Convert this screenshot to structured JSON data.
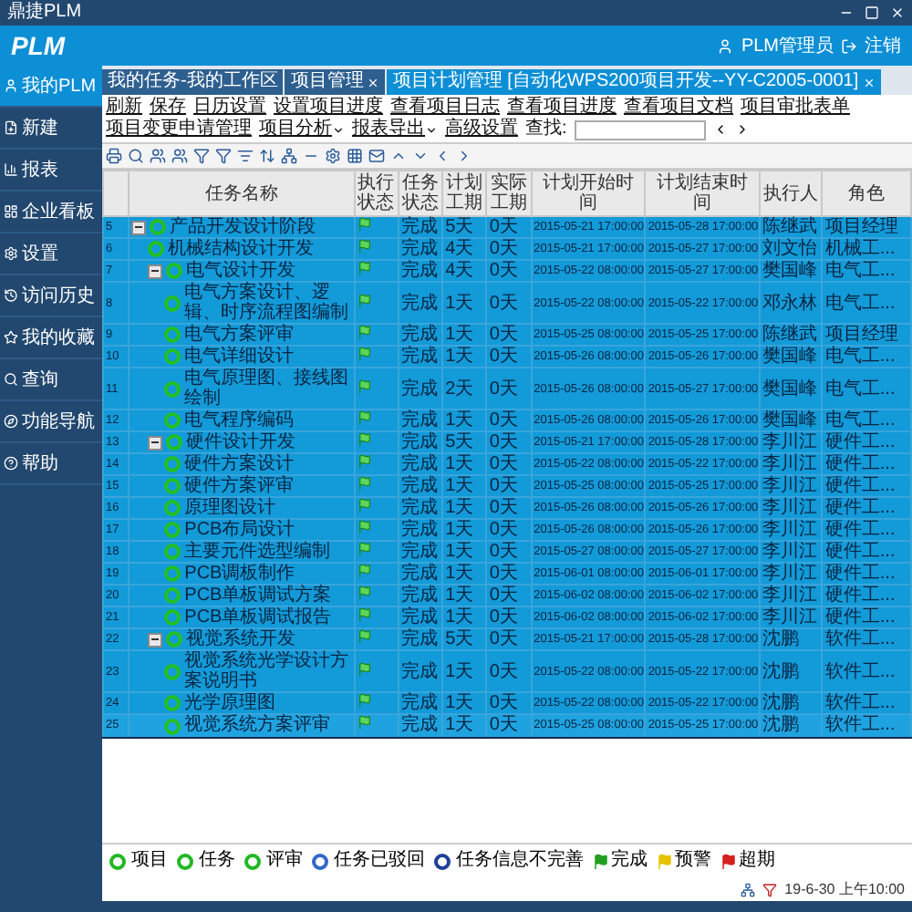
{
  "window": {
    "title": "鼎捷PLM"
  },
  "header": {
    "logo": "PLM",
    "user": "PLM管理员",
    "logout": "注销"
  },
  "sidebar": {
    "items": [
      {
        "label": "我的PLM",
        "selected": true
      },
      {
        "label": "新建",
        "selected": false
      },
      {
        "label": "报表",
        "selected": false
      },
      {
        "label": "企业看板",
        "selected": false
      },
      {
        "label": "设置",
        "selected": false
      },
      {
        "label": "访问历史",
        "selected": false
      },
      {
        "label": "我的收藏",
        "selected": false
      },
      {
        "label": "查询",
        "selected": false
      },
      {
        "label": "功能导航",
        "selected": false
      },
      {
        "label": "帮助",
        "selected": false
      }
    ]
  },
  "tabs": [
    {
      "label": "我的任务-我的工作区",
      "selected": false,
      "closable": false
    },
    {
      "label": "项目管理",
      "selected": false,
      "closable": true
    },
    {
      "label": "项目计划管理 [自动化WPS200项目开发--YY-C2005-0001]",
      "selected": true,
      "closable": true
    }
  ],
  "menu": [
    {
      "label": "刷新",
      "kind": "link"
    },
    {
      "label": "保存",
      "kind": "link"
    },
    {
      "label": "日历设置",
      "kind": "link"
    },
    {
      "label": "设置项目进度",
      "kind": "link"
    },
    {
      "label": "查看项目日志",
      "kind": "link"
    },
    {
      "label": "查看项目进度",
      "kind": "link"
    },
    {
      "label": "查看项目文档",
      "kind": "link"
    },
    {
      "label": "项目审批表单",
      "kind": "link"
    },
    {
      "label": "项目变更申请管理",
      "kind": "link"
    },
    {
      "label": "项目分析",
      "kind": "dropdown"
    },
    {
      "label": "报表导出",
      "kind": "dropdown"
    },
    {
      "label": "高级设置",
      "kind": "link"
    }
  ],
  "search": {
    "label": "查找:"
  },
  "table": {
    "columns": [
      "任务名称",
      "执行状态",
      "任务状态",
      "计划工期",
      "实际工期",
      "计划开始时间",
      "计划结束时间",
      "执行人",
      "角色"
    ],
    "rows": [
      {
        "num": "5",
        "name": "产品开发设计阶段",
        "status": "完成",
        "plan": "5天",
        "actual": "0天",
        "start": "2015-05-21 17:00:00",
        "end": "2015-05-28 17:00:00",
        "person": "陈继武",
        "role": "项目经理",
        "selected": false,
        "expanded": true,
        "children": [
          {
            "num": "6",
            "name": "机械结构设计开发",
            "status": "完成",
            "plan": "4天",
            "actual": "0天",
            "start": "2015-05-21 17:00:00",
            "end": "2015-05-27 17:00:00",
            "person": "刘文怡",
            "role": "机械工...",
            "selected": false
          },
          {
            "num": "7",
            "name": "电气设计开发",
            "status": "完成",
            "plan": "4天",
            "actual": "0天",
            "start": "2015-05-22 08:00:00",
            "end": "2015-05-27 17:00:00",
            "person": "樊国峰",
            "role": "电气工...",
            "selected": false,
            "expanded": true,
            "children": [
              {
                "num": "8",
                "name": "电气方案设计、逻辑、时序流程图编制",
                "status": "完成",
                "plan": "1天",
                "actual": "0天",
                "start": "2015-05-22 08:00:00",
                "end": "2015-05-22 17:00:00",
                "person": "邓永林",
                "role": "电气工...",
                "selected": false
              },
              {
                "num": "9",
                "name": "电气方案评审",
                "status": "完成",
                "plan": "1天",
                "actual": "0天",
                "start": "2015-05-25 08:00:00",
                "end": "2015-05-25 17:00:00",
                "person": "陈继武",
                "role": "项目经理",
                "selected": false
              },
              {
                "num": "10",
                "name": "电气详细设计",
                "status": "完成",
                "plan": "1天",
                "actual": "0天",
                "start": "2015-05-26 08:00:00",
                "end": "2015-05-26 17:00:00",
                "person": "樊国峰",
                "role": "电气工...",
                "selected": false
              },
              {
                "num": "11",
                "name": "电气原理图、接线图绘制",
                "status": "完成",
                "plan": "2天",
                "actual": "0天",
                "start": "2015-05-26 08:00:00",
                "end": "2015-05-27 17:00:00",
                "person": "樊国峰",
                "role": "电气工...",
                "selected": false
              },
              {
                "num": "12",
                "name": "电气程序编码",
                "status": "完成",
                "plan": "1天",
                "actual": "0天",
                "start": "2015-05-26 08:00:00",
                "end": "2015-05-26 17:00:00",
                "person": "樊国峰",
                "role": "电气工...",
                "selected": false
              }
            ]
          },
          {
            "num": "13",
            "name": "硬件设计开发",
            "status": "完成",
            "plan": "5天",
            "actual": "0天",
            "start": "2015-05-21 17:00:00",
            "end": "2015-05-28 17:00:00",
            "person": "李川江",
            "role": "硬件工...",
            "selected": false,
            "expanded": true,
            "children": [
              {
                "num": "14",
                "name": "硬件方案设计",
                "status": "完成",
                "plan": "1天",
                "actual": "0天",
                "start": "2015-05-22 08:00:00",
                "end": "2015-05-22 17:00:00",
                "person": "李川江",
                "role": "硬件工...",
                "selected": false
              },
              {
                "num": "15",
                "name": "硬件方案评审",
                "status": "完成",
                "plan": "1天",
                "actual": "0天",
                "start": "2015-05-25 08:00:00",
                "end": "2015-05-25 17:00:00",
                "person": "李川江",
                "role": "硬件工...",
                "selected": false
              },
              {
                "num": "16",
                "name": "原理图设计",
                "status": "完成",
                "plan": "1天",
                "actual": "0天",
                "start": "2015-05-26 08:00:00",
                "end": "2015-05-26 17:00:00",
                "person": "李川江",
                "role": "硬件工...",
                "selected": false
              },
              {
                "num": "17",
                "name": "PCB布局设计",
                "status": "完成",
                "plan": "1天",
                "actual": "0天",
                "start": "2015-05-26 08:00:00",
                "end": "2015-05-26 17:00:00",
                "person": "李川江",
                "role": "硬件工...",
                "selected": false
              },
              {
                "num": "18",
                "name": "主要元件选型编制",
                "status": "完成",
                "plan": "1天",
                "actual": "0天",
                "start": "2015-05-27 08:00:00",
                "end": "2015-05-27 17:00:00",
                "person": "李川江",
                "role": "硬件工...",
                "selected": false
              },
              {
                "num": "19",
                "name": "PCB调板制作",
                "status": "完成",
                "plan": "1天",
                "actual": "0天",
                "start": "2015-06-01 08:00:00",
                "end": "2015-06-01 17:00:00",
                "person": "李川江",
                "role": "硬件工...",
                "selected": false
              },
              {
                "num": "20",
                "name": "PCB单板调试方案",
                "status": "完成",
                "plan": "1天",
                "actual": "0天",
                "start": "2015-06-02 08:00:00",
                "end": "2015-06-02 17:00:00",
                "person": "李川江",
                "role": "硬件工...",
                "selected": false
              },
              {
                "num": "21",
                "name": "PCB单板调试报告",
                "status": "完成",
                "plan": "1天",
                "actual": "0天",
                "start": "2015-06-02 08:00:00",
                "end": "2015-06-02 17:00:00",
                "person": "李川江",
                "role": "硬件工...",
                "selected": false
              }
            ]
          },
          {
            "num": "22",
            "name": "视觉系统开发",
            "status": "完成",
            "plan": "5天",
            "actual": "0天",
            "start": "2015-05-21 17:00:00",
            "end": "2015-05-28 17:00:00",
            "person": "沈鹏",
            "role": "软件工...",
            "selected": false,
            "expanded": true,
            "children": [
              {
                "num": "23",
                "name": "视觉系统光学设计方案说明书",
                "status": "完成",
                "plan": "1天",
                "actual": "0天",
                "start": "2015-05-22 08:00:00",
                "end": "2015-05-22 17:00:00",
                "person": "沈鹏",
                "role": "软件工...",
                "selected": false
              },
              {
                "num": "24",
                "name": "光学原理图",
                "status": "完成",
                "plan": "1天",
                "actual": "0天",
                "start": "2015-05-22 08:00:00",
                "end": "2015-05-22 17:00:00",
                "person": "沈鹏",
                "role": "软件工...",
                "selected": false
              },
              {
                "num": "25",
                "name": "视觉系统方案评审",
                "status": "完成",
                "plan": "1天",
                "actual": "0天",
                "start": "2015-05-25 08:00:00",
                "end": "2015-05-25 17:00:00",
                "person": "沈鹏",
                "role": "软件工...",
                "selected": true
              }
            ]
          }
        ]
      }
    ]
  },
  "legend": [
    {
      "label": "项目",
      "kind": "ring",
      "color": "#22b722"
    },
    {
      "label": "任务",
      "kind": "ring",
      "color": "#22b722"
    },
    {
      "label": "评审",
      "kind": "ring",
      "color": "#22b722"
    },
    {
      "label": "任务已驳回",
      "kind": "ring",
      "color": "#3366cc"
    },
    {
      "label": "任务信息不完善",
      "kind": "ring",
      "color": "#1f3f99"
    },
    {
      "label": "完成",
      "kind": "flag",
      "color": "#22a022"
    },
    {
      "label": "预警",
      "kind": "flag",
      "color": "#e6c200"
    },
    {
      "label": "超期",
      "kind": "flag",
      "color": "#d42020"
    }
  ],
  "status_bar": {
    "time": "19-6-30 上午10:00"
  }
}
